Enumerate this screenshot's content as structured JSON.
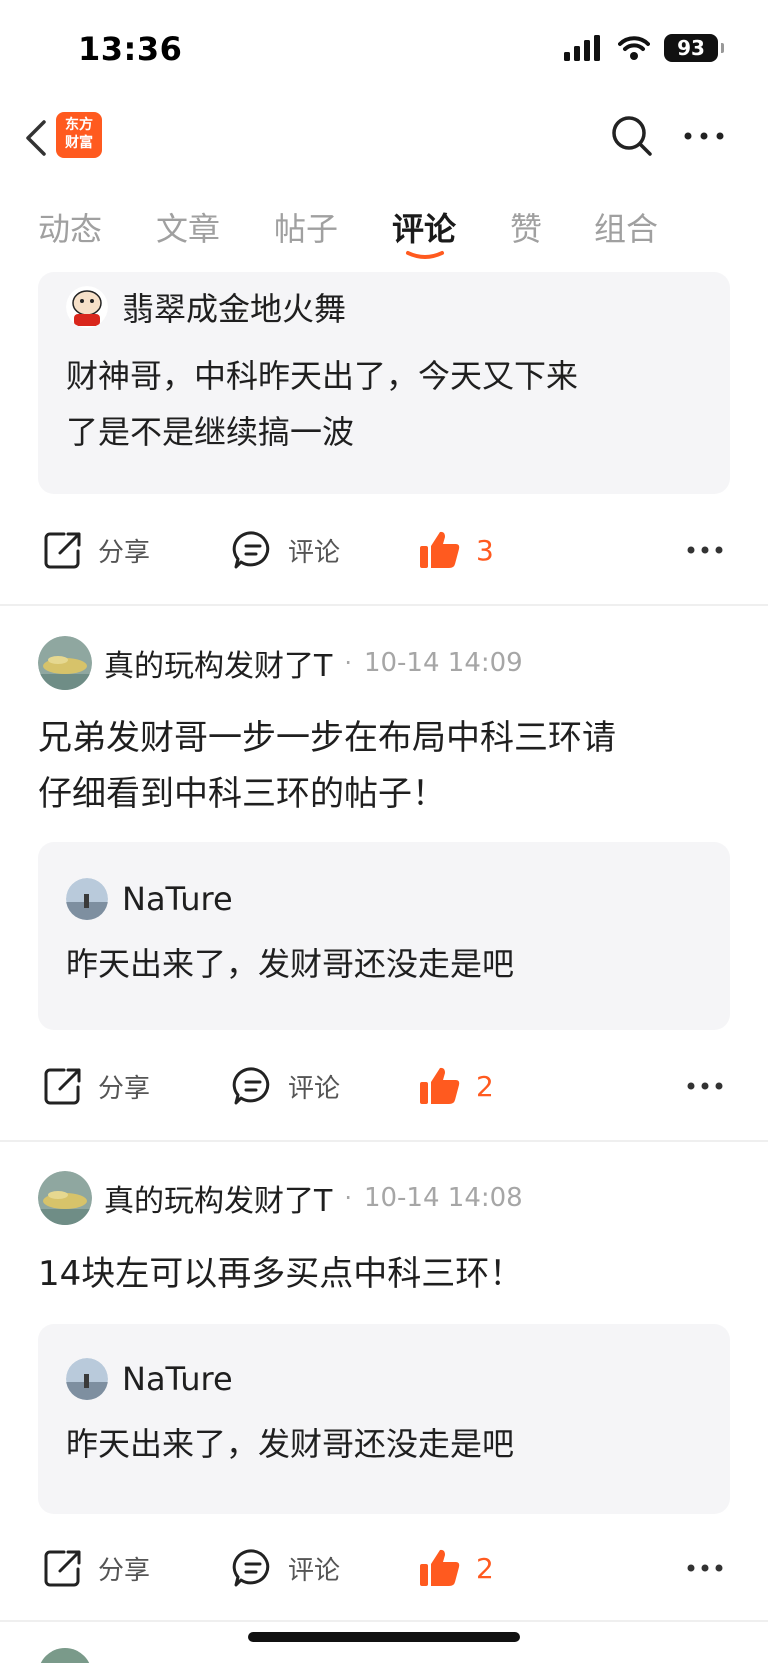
{
  "status": {
    "time": "13:36",
    "battery": "93"
  },
  "nav": {
    "logo_line1": "东方",
    "logo_line2": "财富"
  },
  "tabs": [
    {
      "label": "动态"
    },
    {
      "label": "文章"
    },
    {
      "label": "帖子"
    },
    {
      "label": "评论"
    },
    {
      "label": "赞"
    },
    {
      "label": "组合"
    }
  ],
  "active_tab": "评论",
  "actions": {
    "share": "分享",
    "comment": "评论"
  },
  "items": [
    {
      "quote": {
        "user": "翡翠成金地火舞",
        "text_line1": "财神哥，中科昨天出了，今天又下来",
        "text_line2": "了是不是继续搞一波"
      },
      "likes": "3"
    },
    {
      "user": "真的玩构发财了T",
      "dot": "·",
      "time": "10-14 14:09",
      "text_line1": "兄弟发财哥一步一步在布局中科三环请",
      "text_line2": "仔细看到中科三环的帖子！",
      "quote": {
        "user": "NaTure",
        "text": "昨天出来了，发财哥还没走是吧"
      },
      "likes": "2"
    },
    {
      "user": "真的玩构发财了T",
      "dot": "·",
      "time": "10-14 14:08",
      "text_line1": "14块左可以再多买点中科三环！",
      "quote": {
        "user": "NaTure",
        "text": "昨天出来了，发财哥还没走是吧"
      },
      "likes": "2"
    }
  ],
  "colors": {
    "accent": "#ff5a1f",
    "card_bg": "#f5f5f7",
    "muted": "#a6a6a6"
  }
}
